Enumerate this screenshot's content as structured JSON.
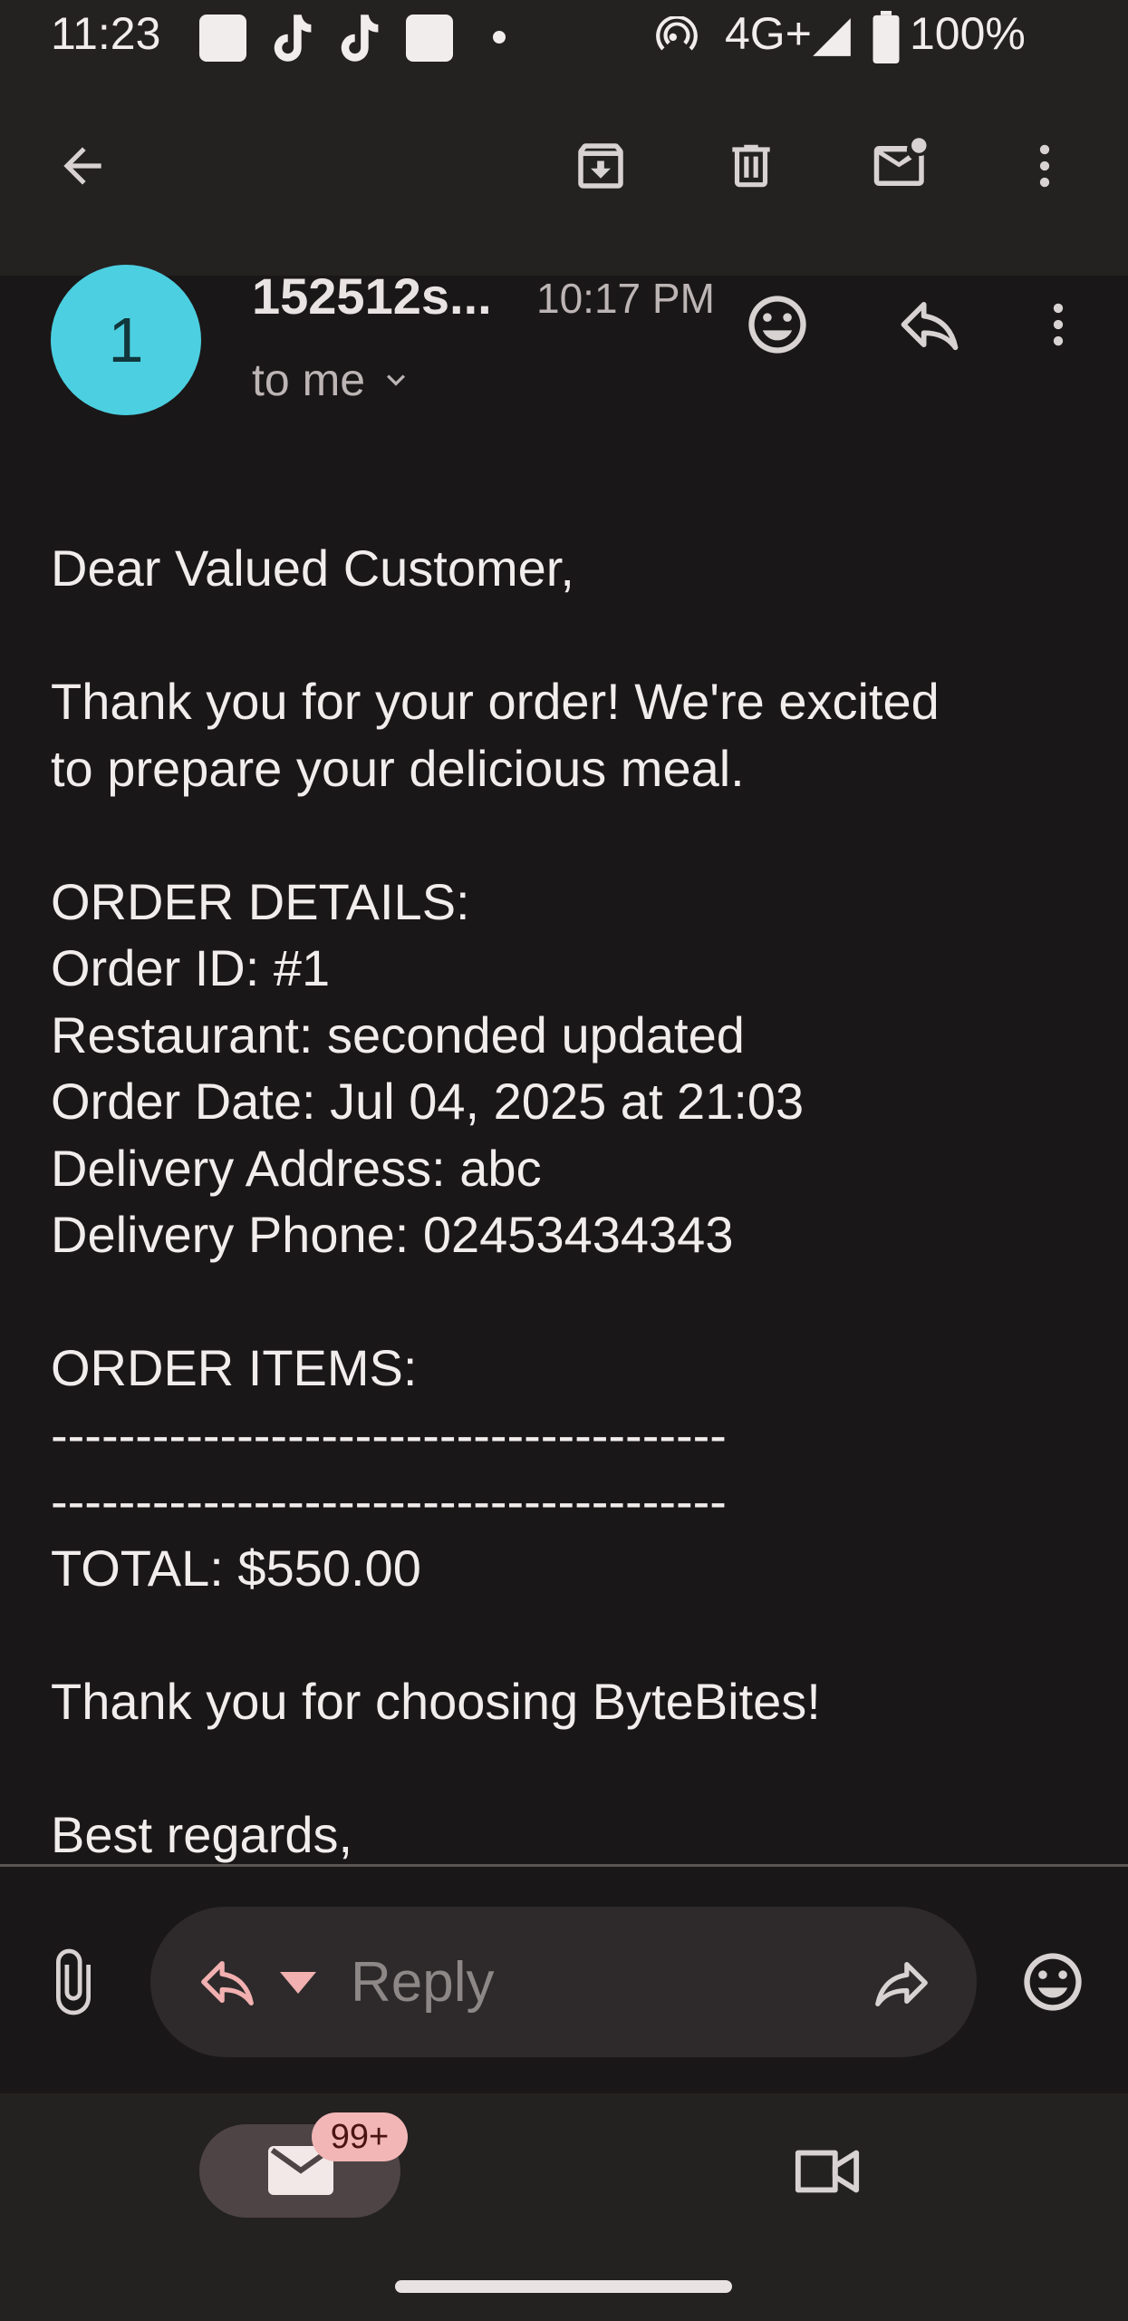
{
  "status_bar": {
    "time": "11:23",
    "network": "4G+",
    "battery": "100%"
  },
  "app_bar": {
    "icons": [
      "back-arrow-icon",
      "archive-icon",
      "delete-icon",
      "mark-unread-icon",
      "more-vert-icon"
    ]
  },
  "email": {
    "avatar_letter": "1",
    "avatar_color": "#4ccfe0",
    "sender": "152512s...",
    "time": "10:17 PM",
    "recipient_label": "to me",
    "body": [
      "Dear Valued Customer,",
      "",
      "Thank you for your order! We're excited",
      "to prepare your delicious meal.",
      "",
      "ORDER DETAILS:",
      "Order ID: #1",
      "Restaurant: seconded updated",
      "Order Date: Jul 04, 2025 at 21:03",
      "Delivery Address: abc",
      "Delivery Phone: 02453434343",
      "",
      "ORDER ITEMS:",
      "----------------------------------------",
      "----------------------------------------",
      "TOTAL: $550.00",
      "",
      "Thank you for choosing ByteBites!",
      "",
      "Best regards,"
    ]
  },
  "compose": {
    "reply_placeholder": "Reply"
  },
  "bottom_nav": {
    "mail_badge": "99+"
  }
}
